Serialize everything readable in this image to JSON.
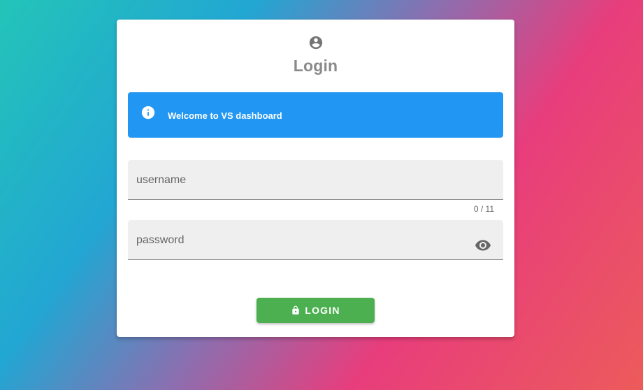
{
  "header": {
    "icon": "account-circle-icon",
    "title": "Login"
  },
  "alert": {
    "icon": "info-icon",
    "message": "Welcome to VS dashboard",
    "color": "#2196f3"
  },
  "form": {
    "username": {
      "value": "",
      "placeholder": "username",
      "counter": "0 / 11"
    },
    "password": {
      "value": "",
      "placeholder": "password",
      "toggle_icon": "eye-icon"
    }
  },
  "login_button": {
    "icon": "lock-icon",
    "label": "LOGIN",
    "color": "#4caf50"
  }
}
